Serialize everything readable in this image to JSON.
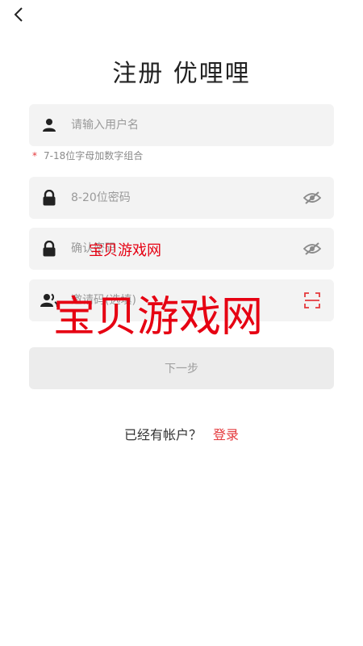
{
  "header": {
    "title": "注册 优哩哩"
  },
  "fields": {
    "username": {
      "placeholder": "请输入用户名"
    },
    "password": {
      "placeholder": "8-20位密码"
    },
    "confirm": {
      "placeholder": "确认密码"
    },
    "invite": {
      "placeholder": "邀请码(选填)"
    }
  },
  "hint": {
    "star": "*",
    "text": "7-18位字母加数字组合"
  },
  "actions": {
    "next_label": "下一步"
  },
  "footer": {
    "question": "已经有帐户？",
    "login_link": "登录"
  },
  "watermark": {
    "small": "宝贝游戏网",
    "large": "宝贝游戏网"
  },
  "colors": {
    "accent": "#e4393c",
    "field_bg": "#f3f3f3",
    "button_bg": "#ececec"
  }
}
